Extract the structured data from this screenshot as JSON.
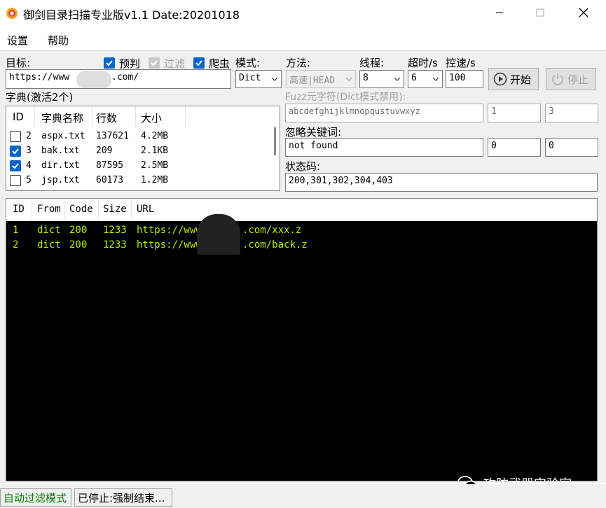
{
  "window": {
    "title": "御剑目录扫描专业版v1.1 Date:20201018",
    "controls": [
      "minimize",
      "maximize",
      "close"
    ]
  },
  "menu": {
    "items": [
      "设置",
      "帮助"
    ]
  },
  "form": {
    "target_label": "目标:",
    "target_value_prefix": "https://www",
    "target_value_suffix": ".com/",
    "dict_count_label": "字典(激活2个)",
    "precheck_label": "预判",
    "filter_label": "过滤",
    "crawler_label": "爬虫",
    "mode_label": "模式:",
    "mode_value": "Dict",
    "method_label": "方法:",
    "method_value": "高速|HEAD",
    "threads_label": "线程:",
    "threads_value": "8",
    "timeout_label": "超时/s",
    "timeout_value": "6",
    "rate_label": "控速/s",
    "rate_value": "100",
    "start_button": "开始",
    "stop_button": "停止",
    "fuzz_label": "Fuzz元字符(Dict模式禁用):",
    "fuzz_chars": "abcdefghijklmnopqustuvwxyz",
    "fuzz_min": "1",
    "fuzz_max": "3",
    "ignore_label": "忽略关键词:",
    "ignore_value": "not found",
    "ignore_a": "0",
    "ignore_b": "0",
    "status_label": "状态码:",
    "status_value": "200,301,302,304,403"
  },
  "dict_table": {
    "headers": [
      "ID",
      "字典名称",
      "行数",
      "大小"
    ],
    "rows": [
      {
        "id": "2",
        "name": "aspx.txt",
        "lines": "137621",
        "size": "4.2MB",
        "checked": false
      },
      {
        "id": "3",
        "name": "bak.txt",
        "lines": "209",
        "size": "2.1KB",
        "checked": true
      },
      {
        "id": "4",
        "name": "dir.txt",
        "lines": "87595",
        "size": "2.5MB",
        "checked": true
      },
      {
        "id": "5",
        "name": "jsp.txt",
        "lines": "60173",
        "size": "1.2MB",
        "checked": false
      }
    ]
  },
  "results_table": {
    "headers": [
      "ID",
      "From",
      "Code",
      "Size",
      "URL"
    ],
    "rows": [
      {
        "id": "1",
        "from": "dict",
        "code": "200",
        "size": "1233",
        "url_prefix": "https://www",
        "url_suffix": ".com/xxx.z"
      },
      {
        "id": "2",
        "from": "dict",
        "code": "200",
        "size": "1233",
        "url_prefix": "https://www",
        "url_suffix": ".com/back.z"
      }
    ]
  },
  "statusbar": {
    "mode": "自动过滤模式",
    "state": "已停止:强制结束..."
  },
  "watermark": "攻防武器实验室",
  "colors": {
    "result_text": "#b4f000",
    "mode_status_text": "#008000",
    "checkbox_checked": "#0a64c8"
  }
}
